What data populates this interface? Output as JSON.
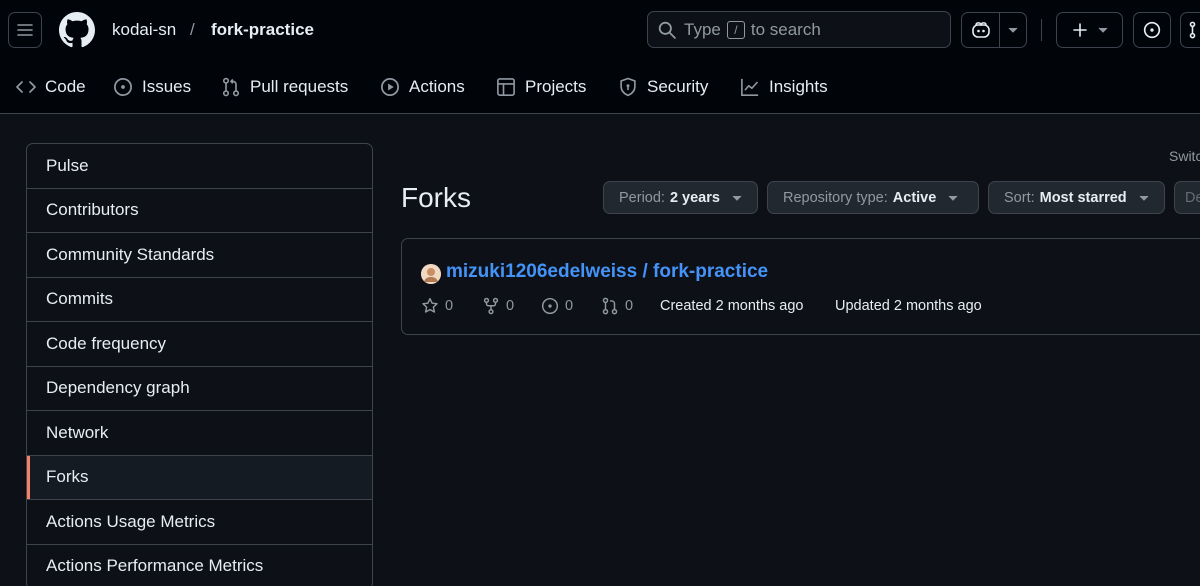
{
  "header": {
    "owner": "kodai-sn",
    "separator": "/",
    "repo": "fork-practice",
    "search": {
      "prefix": "Type",
      "key": "/",
      "suffix": "to search"
    }
  },
  "nav": {
    "tabs": [
      {
        "label": "Code",
        "icon": "code-icon"
      },
      {
        "label": "Issues",
        "icon": "issue-opened-icon"
      },
      {
        "label": "Pull requests",
        "icon": "git-pull-request-icon"
      },
      {
        "label": "Actions",
        "icon": "play-icon"
      },
      {
        "label": "Projects",
        "icon": "table-icon"
      },
      {
        "label": "Security",
        "icon": "shield-icon"
      },
      {
        "label": "Insights",
        "icon": "graph-icon"
      }
    ]
  },
  "sidebar": {
    "items": [
      {
        "label": "Pulse"
      },
      {
        "label": "Contributors"
      },
      {
        "label": "Community Standards"
      },
      {
        "label": "Commits"
      },
      {
        "label": "Code frequency"
      },
      {
        "label": "Dependency graph"
      },
      {
        "label": "Network"
      },
      {
        "label": "Forks",
        "active": true
      },
      {
        "label": "Actions Usage Metrics"
      },
      {
        "label": "Actions Performance Metrics"
      }
    ]
  },
  "main": {
    "switch_text": "Switc",
    "title": "Forks",
    "filters": [
      {
        "label": "Period:",
        "value": "2 years"
      },
      {
        "label": "Repository type:",
        "value": "Active"
      },
      {
        "label": "Sort:",
        "value": "Most starred"
      }
    ],
    "filter_truncated": "De",
    "forks": [
      {
        "owner": "mizuki1206edelweiss",
        "separator": "/",
        "repo": "fork-practice",
        "stars": "0",
        "forks": "0",
        "issues": "0",
        "pulls": "0",
        "created": "Created 2 months ago",
        "updated": "Updated 2 months ago"
      }
    ]
  },
  "colors": {
    "background": "#0d1117",
    "header": "#010409",
    "border": "#3d444d",
    "link": "#4493f8",
    "active_indicator": "#f78166"
  }
}
